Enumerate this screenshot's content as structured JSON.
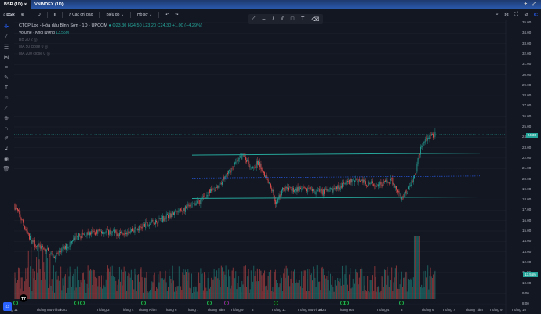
{
  "tabs": [
    {
      "label": "BSR (1D)",
      "close": "×"
    },
    {
      "label": "VNINDEX (1D)"
    }
  ],
  "tabbar_icons": [
    "plus-icon",
    "expand-icon"
  ],
  "toolbar": {
    "symbol": "BSR",
    "interval": "D",
    "indicators": "Các chỉ báo",
    "chart_type": "Biểu đồ",
    "profile": "Hồ sơ"
  },
  "toolbar_right_icons": [
    "zoom-icon",
    "gear-icon",
    "fullscreen-icon",
    "share-icon",
    "brand-icon"
  ],
  "drawing_tools": [
    "brush-icon",
    "horizontal-line-icon",
    "trend-line-icon",
    "parallel-channel-icon",
    "rectangle-icon",
    "text-icon",
    "eraser-icon"
  ],
  "left_tools": [
    "crosshair-icon",
    "trendline-icon",
    "fib-icon",
    "pattern-icon",
    "forecast-icon",
    "brush-icon",
    "text-icon",
    "emoji-icon",
    "ruler-icon",
    "zoom-in-icon",
    "magnet-icon",
    "lock-draw-icon",
    "lock-icon",
    "eye-icon",
    "trash-icon"
  ],
  "legend": {
    "title": "CTCP Lọc - Hóa dầu Bình Sơn · 1D · UPCOM",
    "o": "O23.30",
    "h": "H24.50",
    "l": "L23.20",
    "c": "C24.30",
    "change": "+1.00 (+4.29%)",
    "volume": "Volume · Khối lượng",
    "volume_value": "13.55M",
    "indicators": [
      "BB 20 2",
      "MA 50 close 0",
      "MA 200 close 0"
    ]
  },
  "price_axis": [
    "35.00",
    "34.00",
    "33.00",
    "32.00",
    "31.00",
    "30.00",
    "29.00",
    "28.00",
    "27.00",
    "26.00",
    "25.00",
    "24.00",
    "23.00",
    "22.00",
    "21.00",
    "20.00",
    "19.00",
    "18.00",
    "17.00",
    "16.00",
    "15.00",
    "14.00",
    "13.00",
    "12.00",
    "11.00",
    "10.00",
    "9.00",
    "8.00"
  ],
  "last_price": "24.30",
  "last_volume": "13.55M",
  "time_axis": [
    "Tháng 11",
    "Tháng Mười hai",
    "2023",
    "Tháng 3",
    "Tháng 4",
    "Tháng Năm",
    "Tháng 6",
    "Tháng 7",
    "Tháng Tám",
    "Tháng 9",
    "3",
    "Tháng 11",
    "Tháng Mười hai",
    "2024",
    "Tháng Hai",
    "Tháng 4",
    "3",
    "Tháng 6",
    "Tháng 7",
    "Tháng Tám",
    "Tháng 9",
    "Tháng 10"
  ],
  "levels": {
    "resistance": 22.4,
    "midline_dotted": 20.2,
    "support": 18.2
  },
  "colors": {
    "up": "#26a69a",
    "down": "#ef5350",
    "line": "#26a69a",
    "dotted": "#2962ff",
    "bg": "#131722"
  },
  "logo": "T7"
}
